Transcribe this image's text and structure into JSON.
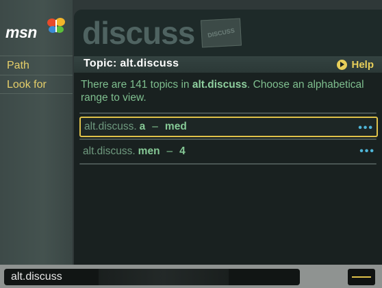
{
  "sidebar": {
    "logo_text": "msn",
    "items": [
      {
        "label": "Path"
      },
      {
        "label": "Look for"
      }
    ]
  },
  "header": {
    "brand_word": "discuss",
    "badge_text": "DISCUSS",
    "topic_title": "Topic: alt.discuss",
    "help_label": "Help"
  },
  "intro": {
    "pre": "There are 141 topics in ",
    "group": "alt.discuss",
    "post": ". Choose an alphabetical range to view."
  },
  "ranges": [
    {
      "prefix": "alt.discuss.",
      "from": "a",
      "dash": "–",
      "to": "med",
      "more": "•••",
      "selected": true
    },
    {
      "prefix": "alt.discuss.",
      "from": "men",
      "dash": "–",
      "to": "4",
      "more": "•••",
      "selected": false
    }
  ],
  "bottom": {
    "address": "alt.discuss"
  },
  "colors": {
    "accent_yellow": "#e0c24a",
    "link_green": "#86c996",
    "dots_blue": "#4fb6d8"
  }
}
